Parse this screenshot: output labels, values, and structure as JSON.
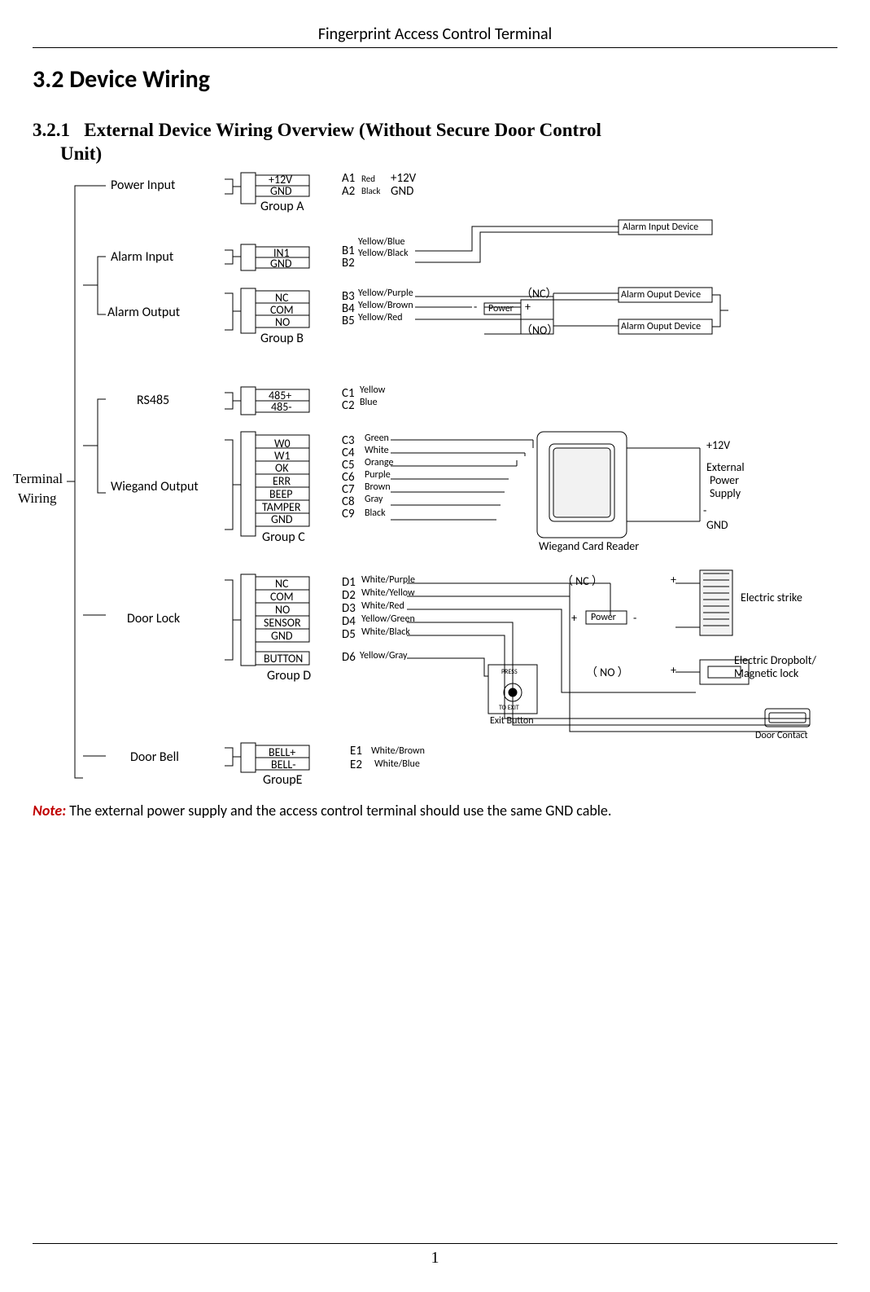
{
  "header": "Fingerprint Access Control Terminal",
  "section": "3.2 Device Wiring",
  "subsection_num": "3.2.1",
  "subsection_title": "External Device Wiring Overview (Without Secure Door Control Unit)",
  "side": {
    "l1": "Terminal",
    "l2": "Wiring"
  },
  "cat": {
    "power": "Power Input",
    "alarmIn": "Alarm Input",
    "alarmOut": "Alarm Output",
    "rs485": "RS485",
    "wieg": "Wiegand Output",
    "lock": "Door Lock",
    "bell": "Door Bell"
  },
  "groups": {
    "a": "Group A",
    "b": "Group B",
    "c": "Group C",
    "d": "Group D",
    "e": "GroupE"
  },
  "A": {
    "p1": "+12V",
    "p2": "GND",
    "l1": "A1",
    "l2": "A2",
    "c1": "Red",
    "c2": "Black",
    "r1": "+12V",
    "r2": "GND"
  },
  "B": {
    "p1": "IN1",
    "p2": "GND",
    "p3": "NC",
    "p4": "COM",
    "p5": "NO",
    "l1": "B1",
    "l2": "B2",
    "l3": "B3",
    "l4": "B4",
    "l5": "B5",
    "c1": "Yellow/Blue",
    "c2": "Yellow/Black",
    "c3": "Yellow/Purple",
    "c4": "Yellow/Brown",
    "c5": "Yellow/Red",
    "dev1": "Alarm Input Device",
    "dev2": "Alarm Ouput Device",
    "dev3": "Alarm Ouput Device",
    "nc": "（NC）",
    "no": "（NO）",
    "pwr": "Power",
    "minus": "-",
    "plus": "+"
  },
  "C": {
    "p1": "485+",
    "p2": "485-",
    "p3": "W0",
    "p4": "W1",
    "p5": "OK",
    "p6": "ERR",
    "p7": "BEEP",
    "p8": "TAMPER",
    "p9": "GND",
    "l1": "C1",
    "l2": "C2",
    "l3": "C3",
    "l4": "C4",
    "l5": "C5",
    "l6": "C6",
    "l7": "C7",
    "l8": "C8",
    "l9": "C9",
    "c1": "Yellow",
    "c2": "Blue",
    "c3": "Green",
    "c4": "White",
    "c5": "Orange",
    "c6": "Purple",
    "c7": "Brown",
    "c8": "Gray",
    "c9": "Black",
    "reader": "Wiegand Card Reader",
    "eps1": "+12V",
    "eps2": "External",
    "eps3": "Power",
    "eps4": "Supply",
    "eps5": "-",
    "eps6": "GND"
  },
  "D": {
    "p1": "NC",
    "p2": "COM",
    "p3": "NO",
    "p4": "SENSOR",
    "p5": "GND",
    "p6": "BUTTON",
    "l1": "D1",
    "l2": "D2",
    "l3": "D3",
    "l4": "D4",
    "l5": "D5",
    "l6": "D6",
    "c1": "White/Purple",
    "c2": "White/Yellow",
    "c3": "White/Red",
    "c4": "Yellow/Green",
    "c5": "White/Black",
    "c6": "Yellow/Gray",
    "nc": "（ NC ）",
    "no": "（ NO  ）",
    "plus": "+",
    "minus": "-",
    "pwr": "Power",
    "strike": "Electric strike",
    "drop1": "Electric Dropbolt/",
    "drop2": "Magnetic lock",
    "exitBtn": "Exit Button",
    "doorContact": "Door Contact",
    "press": "PRESS",
    "toExit": "TO EXIT"
  },
  "E": {
    "p1": "BELL+",
    "p2": "BELL-",
    "l1": "E1",
    "l2": "E2",
    "c1": "White/Brown",
    "c2": "White/Blue"
  },
  "note_label": "Note:",
  "note_text": " The external power supply and the access control terminal should use the same GND cable.",
  "page": "1"
}
